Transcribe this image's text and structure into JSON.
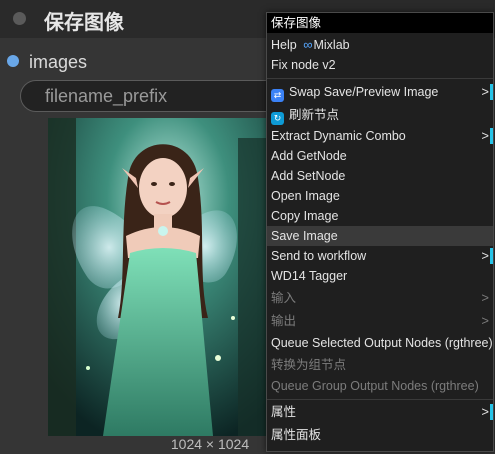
{
  "node": {
    "title": "保存图像",
    "output_label": "images",
    "widget_value": "filename_prefix",
    "image_size": "1024 × 1024"
  },
  "menu": {
    "title": "保存图像",
    "help_label": "Help",
    "help_brand": "Mixlab",
    "items": [
      {
        "label": "Fix node v2"
      },
      {
        "label": "Swap Save/Preview Image",
        "icon": "swap-icon",
        "submenu": true
      },
      {
        "label": "刷新节点",
        "icon": "refresh-icon"
      },
      {
        "label": "Extract Dynamic Combo",
        "submenu": true
      },
      {
        "label": "Add GetNode"
      },
      {
        "label": "Add SetNode"
      },
      {
        "label": "Open Image"
      },
      {
        "label": "Copy Image"
      },
      {
        "label": "Save Image",
        "highlighted": true
      },
      {
        "label": "Send to workflow",
        "submenu": true
      },
      {
        "label": "WD14 Tagger"
      },
      {
        "label": "输入",
        "disabled": true,
        "submenu": true
      },
      {
        "label": "输出",
        "disabled": true,
        "submenu": true
      },
      {
        "label": "Queue Selected Output Nodes (rgthree)"
      },
      {
        "label": "转换为组节点",
        "disabled": true
      },
      {
        "label": "Queue Group Output Nodes (rgthree)",
        "disabled": true
      },
      {
        "label": "属性",
        "submenu": true
      },
      {
        "label": "属性面板"
      }
    ],
    "submenu_glyph": ">",
    "accent": "#27c4e8"
  }
}
